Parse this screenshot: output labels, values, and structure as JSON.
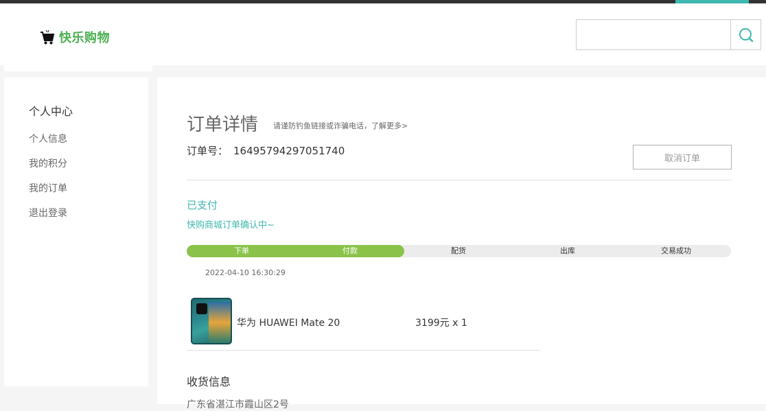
{
  "colors": {
    "accent": "#3fb8af",
    "brand_green": "#4caf50",
    "progress_green": "#8bc34a",
    "topbar": "#333333"
  },
  "header": {
    "logo_text": "快乐购物",
    "logo_icon": "shopping-cart-icon",
    "search": {
      "value": "",
      "placeholder": "",
      "button_icon": "search-icon"
    }
  },
  "sidebar": {
    "title": "个人中心",
    "items": [
      {
        "label": "个人信息"
      },
      {
        "label": "我的积分"
      },
      {
        "label": "我的订单"
      },
      {
        "label": "退出登录"
      }
    ]
  },
  "order": {
    "title": "订单详情",
    "tip": "请谨防钓鱼链接或诈骗电话，了解更多>",
    "number_label": "订单号：",
    "number": "16495794297051740",
    "cancel_label": "取消订单",
    "status": "已支付",
    "status_sub": "快购商城订单确认中~",
    "progress": {
      "completed_fraction": 0.4,
      "steps": [
        {
          "label": "下单",
          "done": true
        },
        {
          "label": "付款",
          "done": true
        },
        {
          "label": "配货",
          "done": false
        },
        {
          "label": "出库",
          "done": false
        },
        {
          "label": "交易成功",
          "done": false
        }
      ],
      "timestamp": "2022-04-10 16:30:29"
    },
    "product": {
      "name": "华为 HUAWEI Mate 20",
      "price_qty": "3199元 x 1"
    },
    "shipping": {
      "title": "收货信息",
      "address": "广东省湛江市霞山区2号"
    }
  }
}
